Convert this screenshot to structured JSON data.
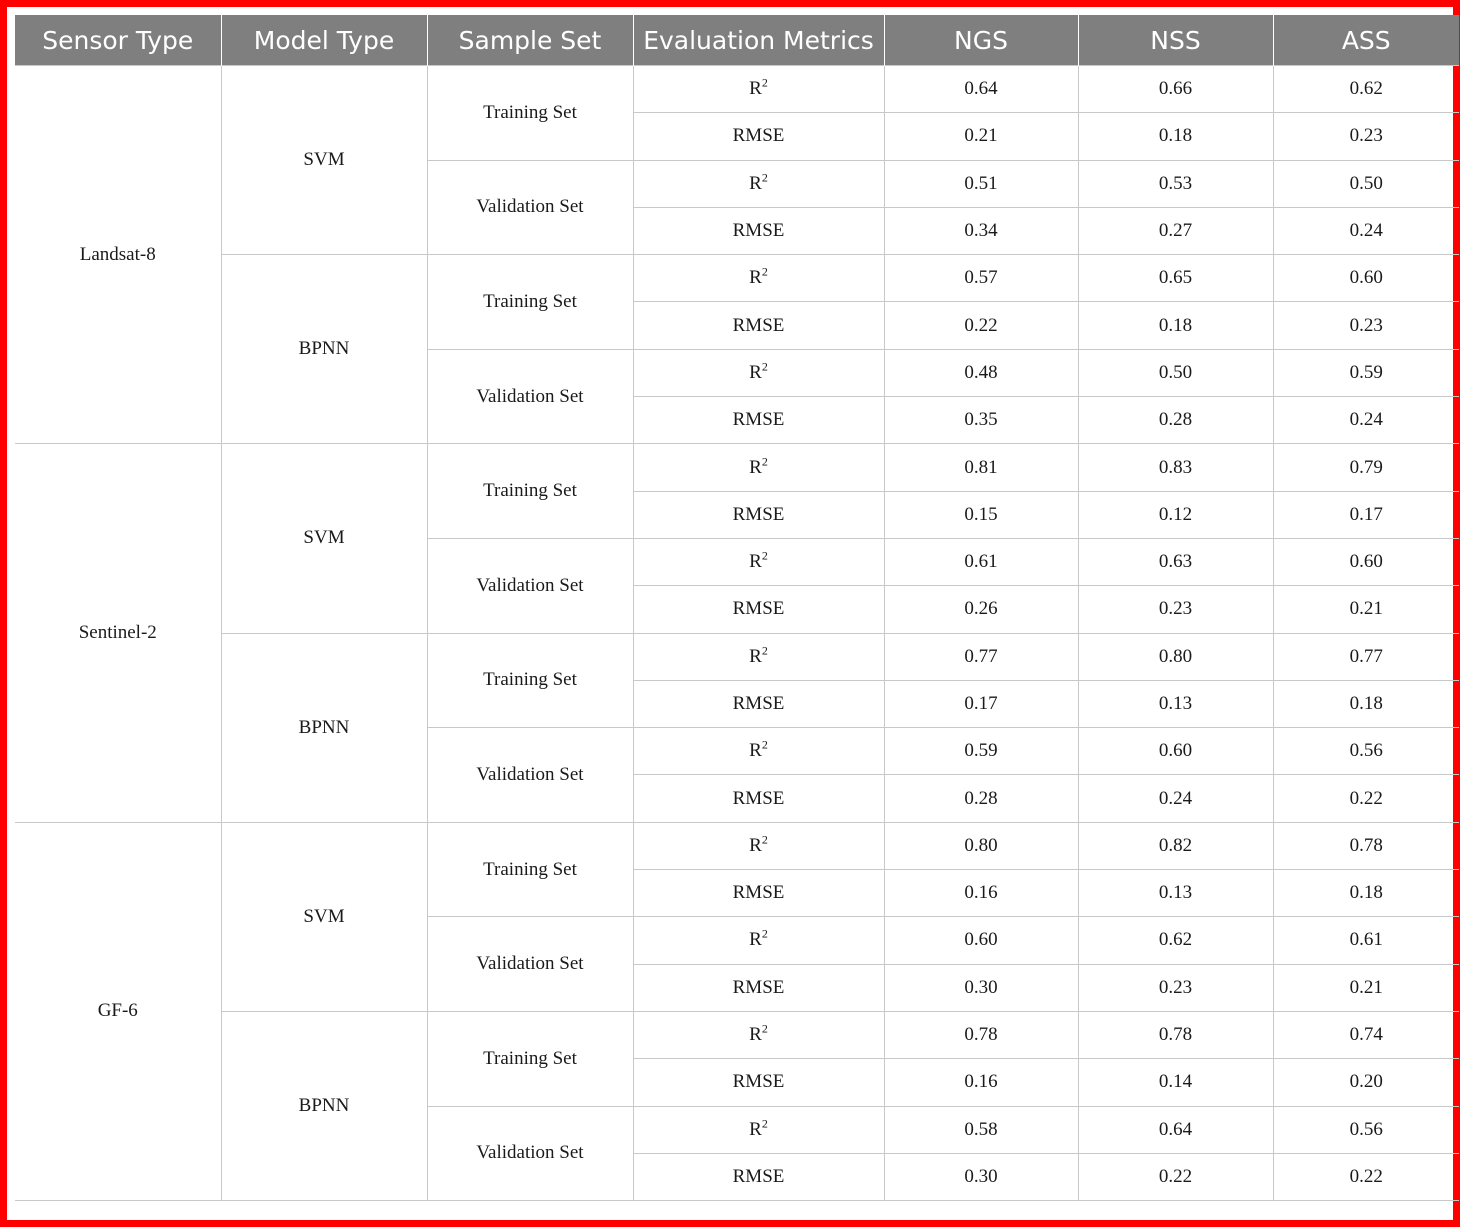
{
  "table": {
    "headers": [
      "Sensor Type",
      "Model Type",
      "Sample Set",
      "Evaluation Metrics",
      "NGS",
      "NSS",
      "ASS"
    ],
    "metric_labels": {
      "r2_base": "R",
      "r2_sup": "2",
      "rmse": "RMSE"
    },
    "sensors": [
      {
        "name": "Landsat-8",
        "models": [
          {
            "name": "SVM",
            "sets": [
              {
                "name": "Training Set",
                "r2": [
                  "0.64",
                  "0.66",
                  "0.62"
                ],
                "rmse": [
                  "0.21",
                  "0.18",
                  "0.23"
                ]
              },
              {
                "name": "Validation Set",
                "r2": [
                  "0.51",
                  "0.53",
                  "0.50"
                ],
                "rmse": [
                  "0.34",
                  "0.27",
                  "0.24"
                ]
              }
            ]
          },
          {
            "name": "BPNN",
            "sets": [
              {
                "name": "Training Set",
                "r2": [
                  "0.57",
                  "0.65",
                  "0.60"
                ],
                "rmse": [
                  "0.22",
                  "0.18",
                  "0.23"
                ]
              },
              {
                "name": "Validation Set",
                "r2": [
                  "0.48",
                  "0.50",
                  "0.59"
                ],
                "rmse": [
                  "0.35",
                  "0.28",
                  "0.24"
                ]
              }
            ]
          }
        ]
      },
      {
        "name": "Sentinel-2",
        "models": [
          {
            "name": "SVM",
            "sets": [
              {
                "name": "Training Set",
                "r2": [
                  "0.81",
                  "0.83",
                  "0.79"
                ],
                "rmse": [
                  "0.15",
                  "0.12",
                  "0.17"
                ]
              },
              {
                "name": "Validation Set",
                "r2": [
                  "0.61",
                  "0.63",
                  "0.60"
                ],
                "rmse": [
                  "0.26",
                  "0.23",
                  "0.21"
                ]
              }
            ]
          },
          {
            "name": "BPNN",
            "sets": [
              {
                "name": "Training Set",
                "r2": [
                  "0.77",
                  "0.80",
                  "0.77"
                ],
                "rmse": [
                  "0.17",
                  "0.13",
                  "0.18"
                ]
              },
              {
                "name": "Validation Set",
                "r2": [
                  "0.59",
                  "0.60",
                  "0.56"
                ],
                "rmse": [
                  "0.28",
                  "0.24",
                  "0.22"
                ]
              }
            ]
          }
        ]
      },
      {
        "name": "GF-6",
        "models": [
          {
            "name": "SVM",
            "sets": [
              {
                "name": "Training Set",
                "r2": [
                  "0.80",
                  "0.82",
                  "0.78"
                ],
                "rmse": [
                  "0.16",
                  "0.13",
                  "0.18"
                ]
              },
              {
                "name": "Validation Set",
                "r2": [
                  "0.60",
                  "0.62",
                  "0.61"
                ],
                "rmse": [
                  "0.30",
                  "0.23",
                  "0.21"
                ]
              }
            ]
          },
          {
            "name": "BPNN",
            "sets": [
              {
                "name": "Training Set",
                "r2": [
                  "0.78",
                  "0.78",
                  "0.74"
                ],
                "rmse": [
                  "0.16",
                  "0.14",
                  "0.20"
                ]
              },
              {
                "name": "Validation Set",
                "r2": [
                  "0.58",
                  "0.64",
                  "0.56"
                ],
                "rmse": [
                  "0.30",
                  "0.22",
                  "0.22"
                ]
              }
            ]
          }
        ]
      }
    ]
  }
}
